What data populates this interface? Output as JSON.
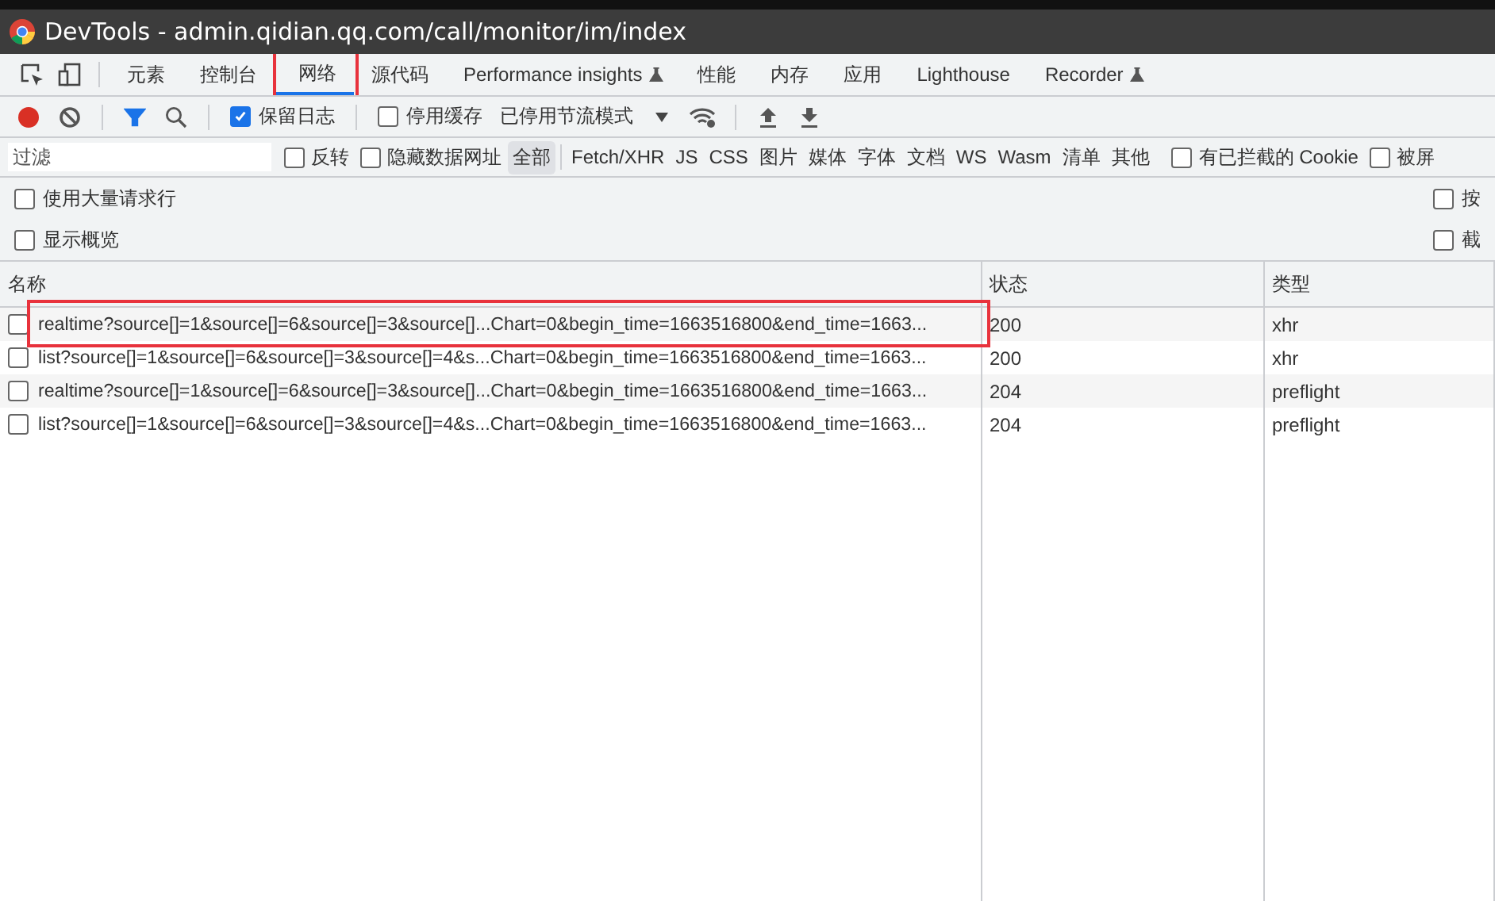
{
  "window": {
    "title": "DevTools - admin.qidian.qq.com/call/monitor/im/index"
  },
  "tabs": [
    {
      "label": "元素",
      "selected": false,
      "highlighted": false,
      "experimental": false
    },
    {
      "label": "控制台",
      "selected": false,
      "highlighted": false,
      "experimental": false
    },
    {
      "label": "网络",
      "selected": true,
      "highlighted": true,
      "experimental": false
    },
    {
      "label": "源代码",
      "selected": false,
      "highlighted": false,
      "experimental": false
    },
    {
      "label": "Performance insights",
      "selected": false,
      "highlighted": false,
      "experimental": true
    },
    {
      "label": "性能",
      "selected": false,
      "highlighted": false,
      "experimental": false
    },
    {
      "label": "内存",
      "selected": false,
      "highlighted": false,
      "experimental": false
    },
    {
      "label": "应用",
      "selected": false,
      "highlighted": false,
      "experimental": false
    },
    {
      "label": "Lighthouse",
      "selected": false,
      "highlighted": false,
      "experimental": false
    },
    {
      "label": "Recorder",
      "selected": false,
      "highlighted": false,
      "experimental": true
    }
  ],
  "toolbar": {
    "filter_on": true,
    "preserve_log": {
      "label": "保留日志",
      "checked": true
    },
    "disable_cache": {
      "label": "停用缓存",
      "checked": false
    },
    "throttling": "已停用节流模式"
  },
  "filter_bar": {
    "placeholder": "过滤",
    "checks_left": [
      {
        "label": "反转",
        "checked": false
      },
      {
        "label": "隐藏数据网址",
        "checked": false
      }
    ],
    "types": [
      {
        "label": "全部",
        "selected": true
      },
      {
        "label": "Fetch/XHR",
        "selected": false
      },
      {
        "label": "JS",
        "selected": false
      },
      {
        "label": "CSS",
        "selected": false
      },
      {
        "label": "图片",
        "selected": false
      },
      {
        "label": "媒体",
        "selected": false
      },
      {
        "label": "字体",
        "selected": false
      },
      {
        "label": "文档",
        "selected": false
      },
      {
        "label": "WS",
        "selected": false
      },
      {
        "label": "Wasm",
        "selected": false
      },
      {
        "label": "清单",
        "selected": false
      },
      {
        "label": "其他",
        "selected": false
      }
    ],
    "checks_right": [
      {
        "label": "有已拦截的 Cookie",
        "checked": false
      },
      {
        "label": "被屏",
        "checked": false
      }
    ]
  },
  "options": {
    "left": [
      {
        "label": "使用大量请求行",
        "checked": false
      },
      {
        "label": "显示概览",
        "checked": false
      }
    ],
    "right": [
      {
        "label": "按",
        "checked": false
      },
      {
        "label": "截",
        "checked": false
      }
    ]
  },
  "table": {
    "columns": [
      "名称",
      "状态",
      "类型"
    ],
    "rows": [
      {
        "name": "realtime?source[]=1&source[]=6&source[]=3&source[]...Chart=0&begin_time=1663516800&end_time=1663...",
        "status": "200",
        "type": "xhr",
        "checked": false,
        "highlighted": true
      },
      {
        "name": "list?source[]=1&source[]=6&source[]=3&source[]=4&s...Chart=0&begin_time=1663516800&end_time=1663...",
        "status": "200",
        "type": "xhr",
        "checked": false,
        "highlighted": false
      },
      {
        "name": "realtime?source[]=1&source[]=6&source[]=3&source[]...Chart=0&begin_time=1663516800&end_time=1663...",
        "status": "204",
        "type": "preflight",
        "checked": false,
        "highlighted": false
      },
      {
        "name": "list?source[]=1&source[]=6&source[]=3&source[]=4&s...Chart=0&begin_time=1663516800&end_time=1663...",
        "status": "204",
        "type": "preflight",
        "checked": false,
        "highlighted": false
      }
    ]
  }
}
